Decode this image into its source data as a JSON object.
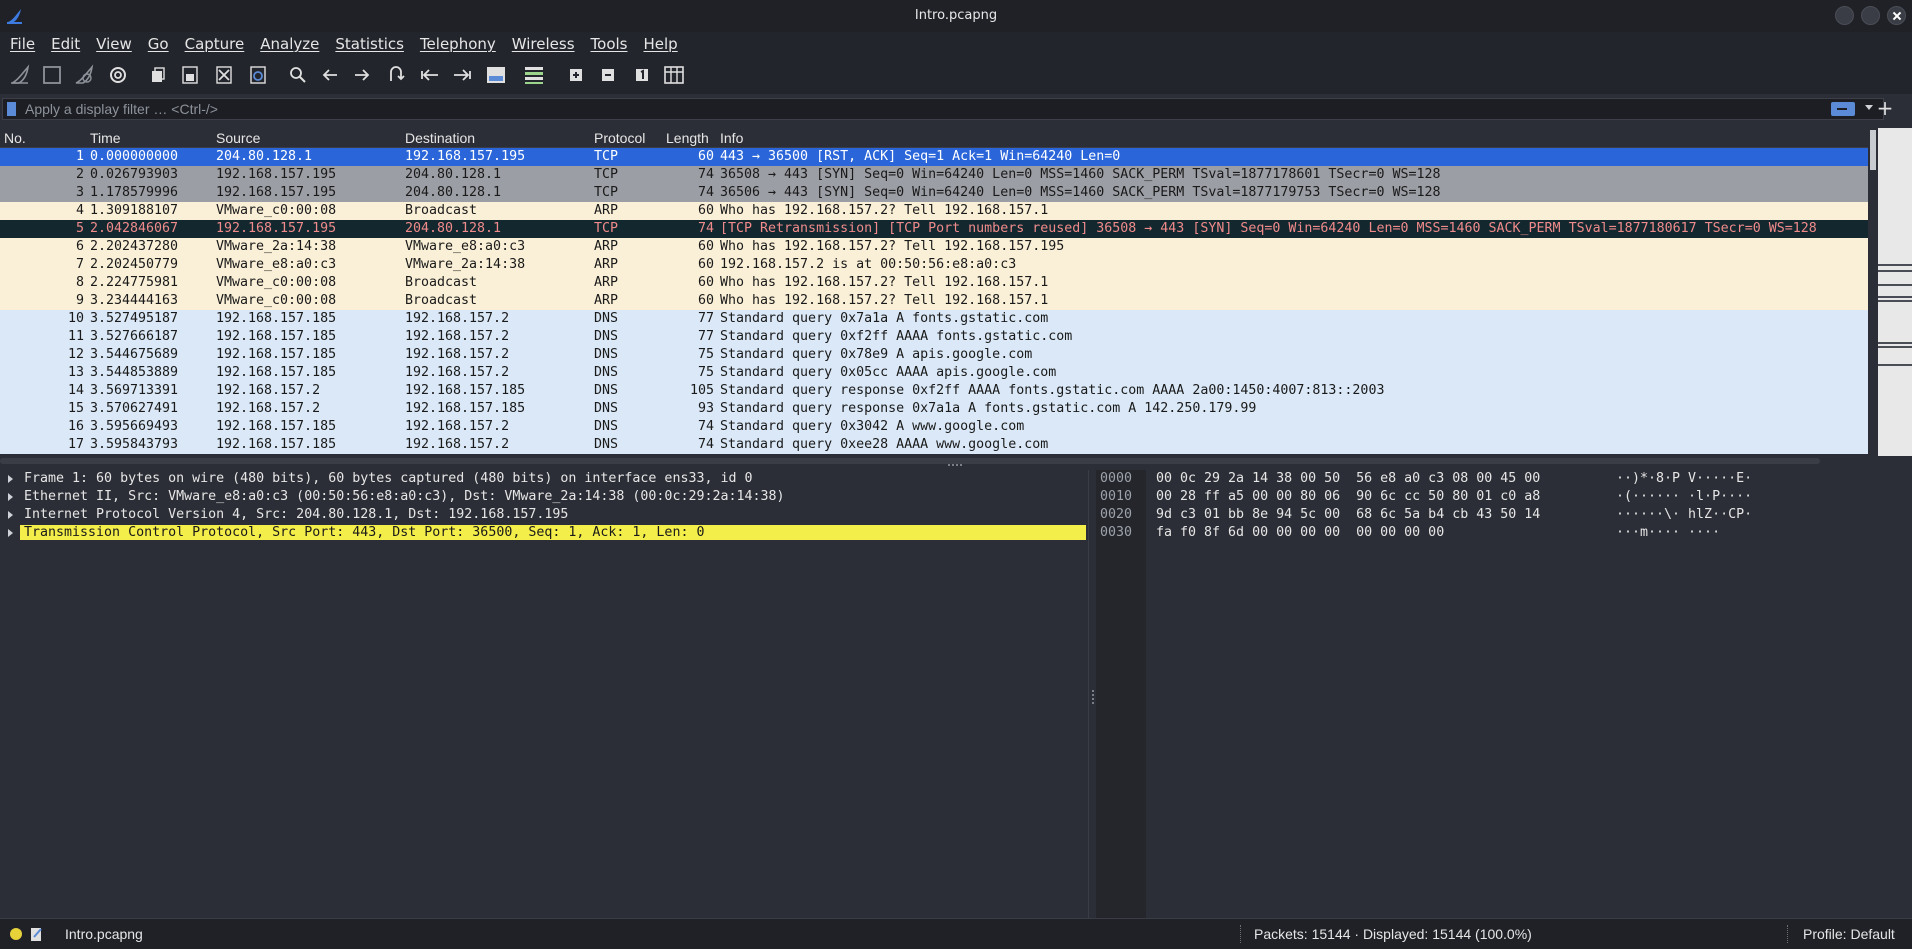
{
  "window": {
    "title": "Intro.pcapng"
  },
  "menu": [
    "File",
    "Edit",
    "View",
    "Go",
    "Capture",
    "Analyze",
    "Statistics",
    "Telephony",
    "Wireless",
    "Tools",
    "Help"
  ],
  "toolbar": {
    "icons": [
      "start-capture-icon",
      "stop-capture-icon",
      "restart-capture-icon",
      "capture-options-icon",
      "open-file-icon",
      "save-file-icon",
      "close-file-icon",
      "reload-file-icon",
      "find-packet-icon",
      "go-back-icon",
      "go-forward-icon",
      "go-to-packet-icon",
      "go-first-icon",
      "go-last-icon",
      "auto-scroll-icon",
      "colorize-icon",
      "zoom-in-icon",
      "zoom-out-icon",
      "normal-size-icon",
      "resize-columns-icon"
    ]
  },
  "filter": {
    "placeholder": "Apply a display filter … <Ctrl-/>"
  },
  "packet_list": {
    "columns": [
      "No.",
      "Time",
      "Source",
      "Destination",
      "Protocol",
      "Length",
      "Info"
    ],
    "rows": [
      {
        "no": "1",
        "time": "0.000000000",
        "src": "204.80.128.1",
        "dst": "192.168.157.195",
        "proto": "TCP",
        "len": "60",
        "info": "443 → 36500 [RST, ACK] Seq=1 Ack=1 Win=64240 Len=0",
        "style": "sel"
      },
      {
        "no": "2",
        "time": "0.026793903",
        "src": "192.168.157.195",
        "dst": "204.80.128.1",
        "proto": "TCP",
        "len": "74",
        "info": "36508 → 443 [SYN] Seq=0 Win=64240 Len=0 MSS=1460 SACK_PERM TSval=1877178601 TSecr=0 WS=128",
        "style": "tcp"
      },
      {
        "no": "3",
        "time": "1.178579996",
        "src": "192.168.157.195",
        "dst": "204.80.128.1",
        "proto": "TCP",
        "len": "74",
        "info": "36506 → 443 [SYN] Seq=0 Win=64240 Len=0 MSS=1460 SACK_PERM TSval=1877179753 TSecr=0 WS=128",
        "style": "tcp"
      },
      {
        "no": "4",
        "time": "1.309188107",
        "src": "VMware_c0:00:08",
        "dst": "Broadcast",
        "proto": "ARP",
        "len": "60",
        "info": "Who has 192.168.157.2? Tell 192.168.157.1",
        "style": "arp"
      },
      {
        "no": "5",
        "time": "2.042846067",
        "src": "192.168.157.195",
        "dst": "204.80.128.1",
        "proto": "TCP",
        "len": "74",
        "info": "[TCP Retransmission] [TCP Port numbers reused] 36508 → 443 [SYN] Seq=0 Win=64240 Len=0 MSS=1460 SACK_PERM TSval=1877180617 TSecr=0 WS=128",
        "style": "bad"
      },
      {
        "no": "6",
        "time": "2.202437280",
        "src": "VMware_2a:14:38",
        "dst": "VMware_e8:a0:c3",
        "proto": "ARP",
        "len": "60",
        "info": "Who has 192.168.157.2? Tell 192.168.157.195",
        "style": "arp"
      },
      {
        "no": "7",
        "time": "2.202450779",
        "src": "VMware_e8:a0:c3",
        "dst": "VMware_2a:14:38",
        "proto": "ARP",
        "len": "60",
        "info": "192.168.157.2 is at 00:50:56:e8:a0:c3",
        "style": "arp"
      },
      {
        "no": "8",
        "time": "2.224775981",
        "src": "VMware_c0:00:08",
        "dst": "Broadcast",
        "proto": "ARP",
        "len": "60",
        "info": "Who has 192.168.157.2? Tell 192.168.157.1",
        "style": "arp"
      },
      {
        "no": "9",
        "time": "3.234444163",
        "src": "VMware_c0:00:08",
        "dst": "Broadcast",
        "proto": "ARP",
        "len": "60",
        "info": "Who has 192.168.157.2? Tell 192.168.157.1",
        "style": "arp"
      },
      {
        "no": "10",
        "time": "3.527495187",
        "src": "192.168.157.185",
        "dst": "192.168.157.2",
        "proto": "DNS",
        "len": "77",
        "info": "Standard query 0x7a1a A fonts.gstatic.com",
        "style": "dns"
      },
      {
        "no": "11",
        "time": "3.527666187",
        "src": "192.168.157.185",
        "dst": "192.168.157.2",
        "proto": "DNS",
        "len": "77",
        "info": "Standard query 0xf2ff AAAA fonts.gstatic.com",
        "style": "dns"
      },
      {
        "no": "12",
        "time": "3.544675689",
        "src": "192.168.157.185",
        "dst": "192.168.157.2",
        "proto": "DNS",
        "len": "75",
        "info": "Standard query 0x78e9 A apis.google.com",
        "style": "dns"
      },
      {
        "no": "13",
        "time": "3.544853889",
        "src": "192.168.157.185",
        "dst": "192.168.157.2",
        "proto": "DNS",
        "len": "75",
        "info": "Standard query 0x05cc AAAA apis.google.com",
        "style": "dns"
      },
      {
        "no": "14",
        "time": "3.569713391",
        "src": "192.168.157.2",
        "dst": "192.168.157.185",
        "proto": "DNS",
        "len": "105",
        "info": "Standard query response 0xf2ff AAAA fonts.gstatic.com AAAA 2a00:1450:4007:813::2003",
        "style": "dns"
      },
      {
        "no": "15",
        "time": "3.570627491",
        "src": "192.168.157.2",
        "dst": "192.168.157.185",
        "proto": "DNS",
        "len": "93",
        "info": "Standard query response 0x7a1a A fonts.gstatic.com A 142.250.179.99",
        "style": "dns"
      },
      {
        "no": "16",
        "time": "3.595669493",
        "src": "192.168.157.185",
        "dst": "192.168.157.2",
        "proto": "DNS",
        "len": "74",
        "info": "Standard query 0x3042 A www.google.com",
        "style": "dns"
      },
      {
        "no": "17",
        "time": "3.595843793",
        "src": "192.168.157.185",
        "dst": "192.168.157.2",
        "proto": "DNS",
        "len": "74",
        "info": "Standard query 0xee28 AAAA www.google.com",
        "style": "dns"
      }
    ]
  },
  "details": [
    {
      "text": "Frame 1: 60 bytes on wire (480 bits), 60 bytes captured (480 bits) on interface ens33, id 0",
      "highlight": false
    },
    {
      "text": "Ethernet II, Src: VMware_e8:a0:c3 (00:50:56:e8:a0:c3), Dst: VMware_2a:14:38 (00:0c:29:2a:14:38)",
      "highlight": false
    },
    {
      "text": "Internet Protocol Version 4, Src: 204.80.128.1, Dst: 192.168.157.195",
      "highlight": false
    },
    {
      "text": "Transmission Control Protocol, Src Port: 443, Dst Port: 36500, Seq: 1, Ack: 1, Len: 0",
      "highlight": true
    }
  ],
  "bytes": [
    {
      "off": "0000",
      "hex": "00 0c 29 2a 14 38 00 50  56 e8 a0 c3 08 00 45 00",
      "ascii": "··)*·8·P V·····E·"
    },
    {
      "off": "0010",
      "hex": "00 28 ff a5 00 00 80 06  90 6c cc 50 80 01 c0 a8",
      "ascii": "·(······ ·l·P····"
    },
    {
      "off": "0020",
      "hex": "9d c3 01 bb 8e 94 5c 00  68 6c 5a b4 cb 43 50 14",
      "ascii": "······\\· hlZ··CP·"
    },
    {
      "off": "0030",
      "hex": "fa f0 8f 6d 00 00 00 00  00 00 00 00",
      "ascii": "···m···· ····"
    }
  ],
  "status": {
    "file": "Intro.pcapng",
    "packets": "Packets: 15144 · Displayed: 15144 (100.0%)",
    "profile": "Profile: Default"
  },
  "colors": {
    "selected_row": "#2a66d9",
    "tcp_row": "#9b9ea4",
    "arp_row": "#faf0d7",
    "bad_tcp_row": "#12272e",
    "dns_row": "#dae8f7",
    "highlight_detail": "#f4ee4a"
  }
}
